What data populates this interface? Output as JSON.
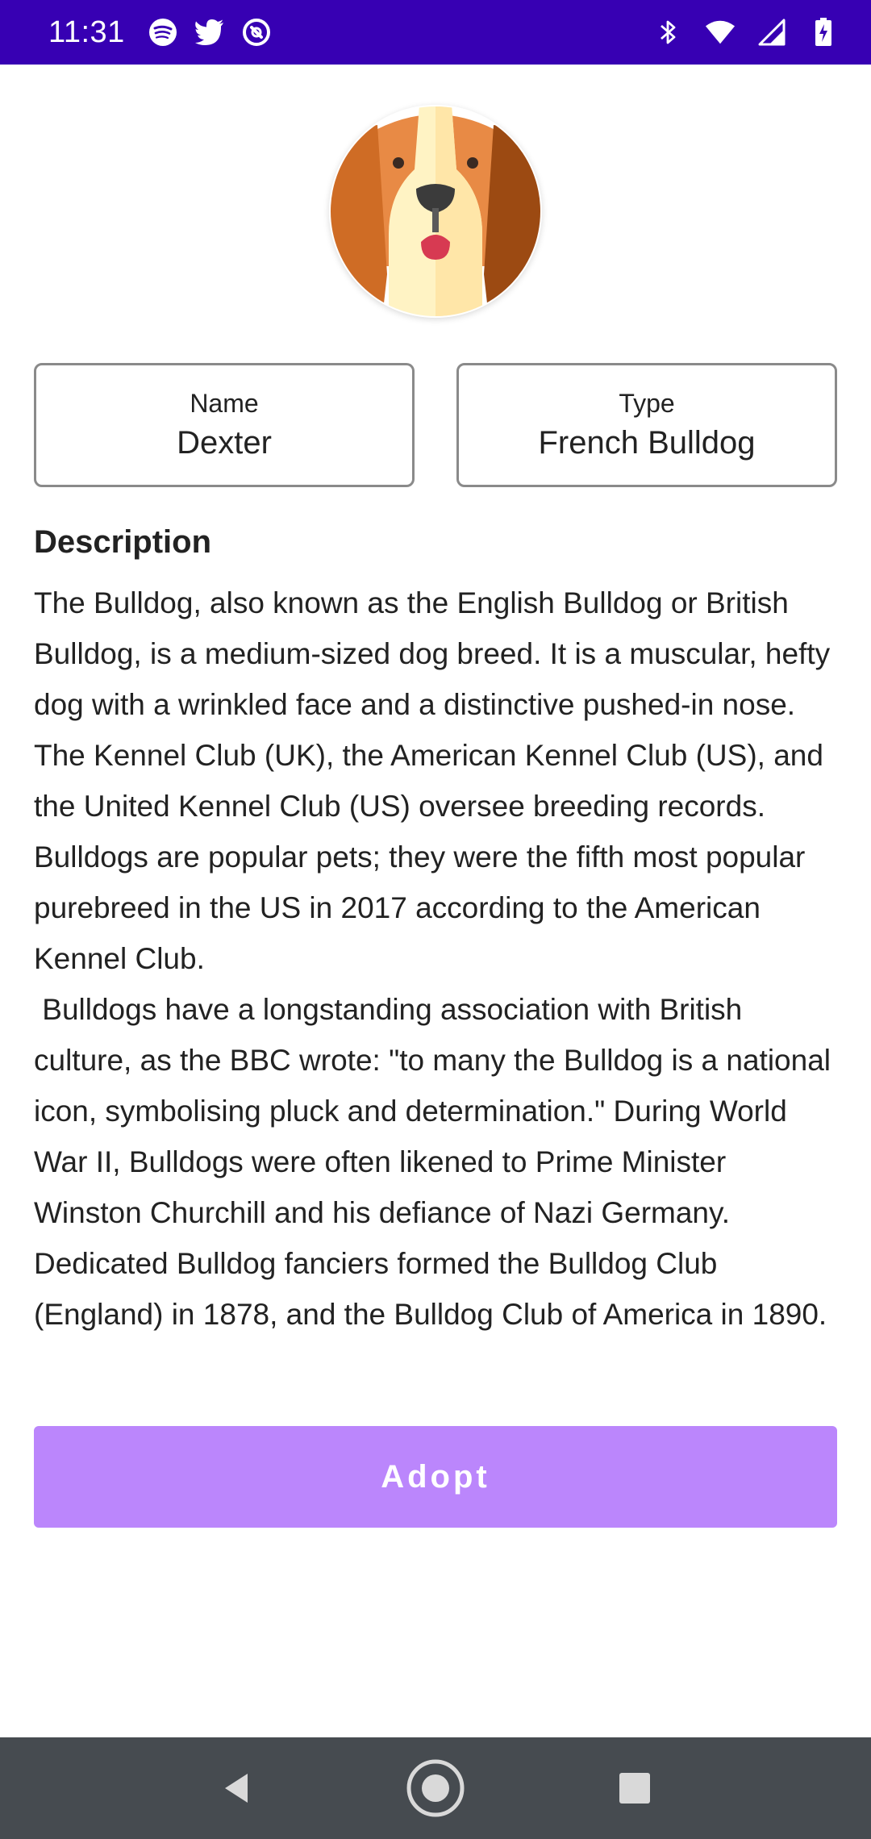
{
  "status_bar": {
    "time": "11:31",
    "left_icons": [
      "spotify-icon",
      "twitter-icon",
      "at-sign-icon"
    ],
    "right_icons": [
      "bluetooth-icon",
      "wifi-icon",
      "signal-icon",
      "battery-icon"
    ]
  },
  "pet": {
    "avatar_icon": "dog-face-icon",
    "name_label": "Name",
    "name_value": "Dexter",
    "type_label": "Type",
    "type_value": "French Bulldog"
  },
  "description": {
    "heading": "Description",
    "paragraph_1": "The Bulldog, also known as the English Bulldog or British Bulldog, is a medium-sized dog breed. It is a muscular, hefty dog with a wrinkled face and a distinctive pushed-in nose. The Kennel Club (UK), the American Kennel Club (US), and the United Kennel Club (US) oversee breeding records. Bulldogs are popular pets; they were the fifth most popular purebreed in the US in 2017 according to the American Kennel Club.",
    "paragraph_2": " Bulldogs have a longstanding association with British culture, as the BBC wrote: \"to many the Bulldog is a national icon, symbolising pluck and determination.\" During World War II, Bulldogs were often likened to Prime Minister Winston Churchill and his defiance of Nazi Germany. Dedicated Bulldog fanciers formed the Bulldog Club (England) in 1878, and the Bulldog Club of America in 1890."
  },
  "actions": {
    "adopt_label": "Adopt"
  },
  "nav_bar": {
    "buttons": [
      "back-icon",
      "home-icon",
      "recents-icon"
    ]
  },
  "colors": {
    "status_bar": "#3700b3",
    "accent": "#bb86fc",
    "nav_bar": "#464b50"
  }
}
